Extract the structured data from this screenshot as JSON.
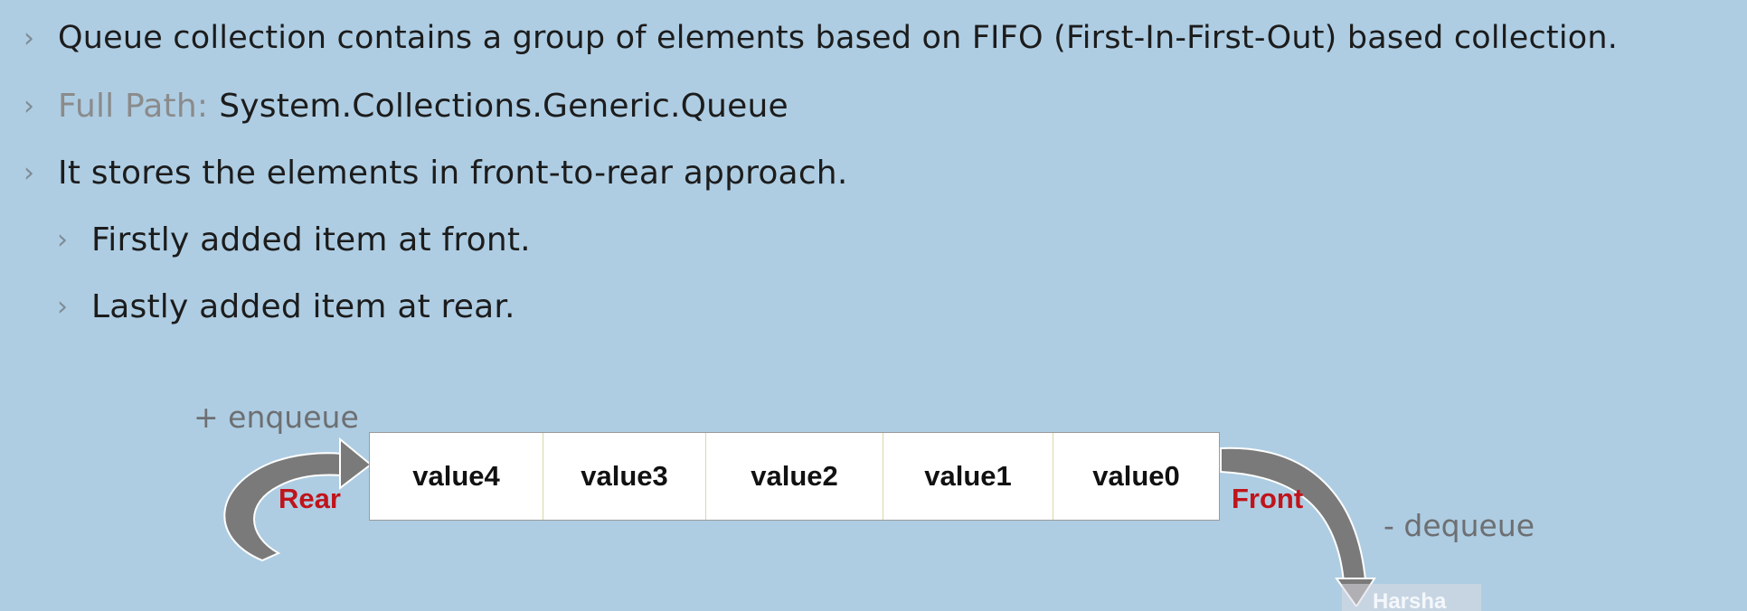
{
  "bullets": [
    {
      "text": "Queue collection contains a group of elements based on FIFO (First-In-First-Out) based collection."
    },
    {
      "label": "Full Path:",
      "text": "System.Collections.Generic.Queue"
    },
    {
      "text": "It stores the elements in front-to-rear approach."
    },
    {
      "text": "Firstly added item at front."
    },
    {
      "text": "Lastly added item at rear."
    }
  ],
  "diagram": {
    "enqueue_label": "+ enqueue",
    "dequeue_label": "- dequeue",
    "rear_label": "Rear",
    "front_label": "Front",
    "cells": [
      "value4",
      "value3",
      "value2",
      "value1",
      "value0"
    ],
    "watermark": "Harsha"
  },
  "colors": {
    "background": "#aecde3",
    "end_label": "#c0141b",
    "arrow": "#7a7a7a"
  }
}
